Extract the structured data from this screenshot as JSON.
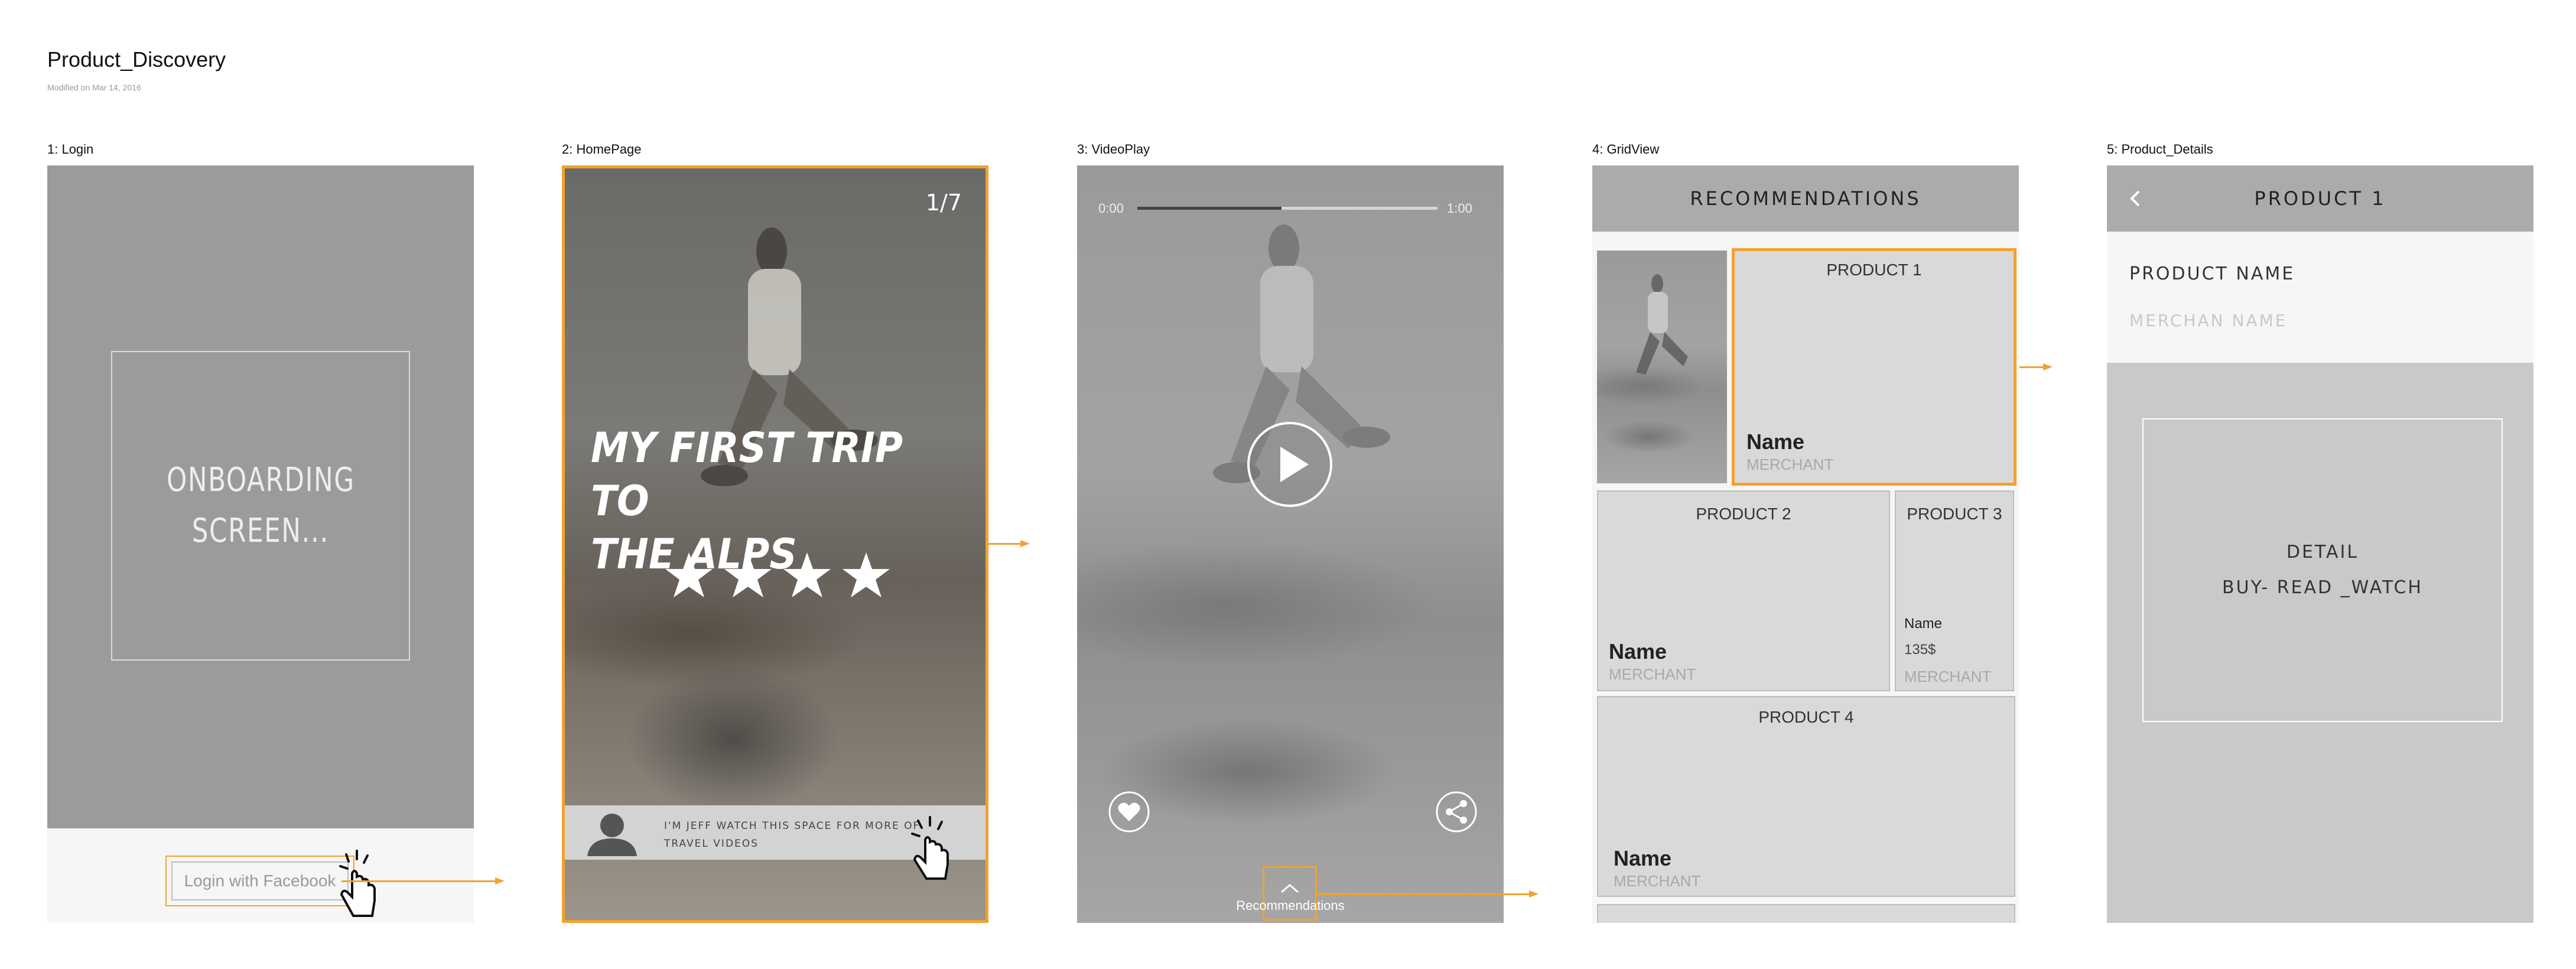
{
  "document": {
    "title": "Product_Discovery",
    "modified": "Modified on Mar 14, 2016"
  },
  "screens": [
    {
      "label": "1: Login"
    },
    {
      "label": "2: HomePage"
    },
    {
      "label": "3: VideoPlay"
    },
    {
      "label": "4: GridView"
    },
    {
      "label": "5: Product_Details"
    }
  ],
  "login": {
    "onboarding_line1": "ONBOARDING",
    "onboarding_line2": "SCREEN...",
    "facebook_button": "Login with Facebook"
  },
  "homepage": {
    "counter": "1/7",
    "headline_line1": "MY FIRST TRIP TO",
    "headline_line2": "THE ALPS",
    "rating": 4,
    "author_line1": "I'M JEFF WATCH THIS SPACE FOR MORE OF",
    "author_line2": "TRAVEL VIDEOS"
  },
  "videoplay": {
    "time_start": "0:00",
    "time_end": "1:00",
    "progress": 0.48,
    "recommendations_label": "Recommendations"
  },
  "gridview": {
    "header": "RECOMMENDATIONS",
    "products": [
      {
        "title": "PRODUCT 1",
        "name": "Name",
        "merchant": "MERCHANT"
      },
      {
        "title": "PRODUCT 2",
        "name": "Name",
        "merchant": "MERCHANT"
      },
      {
        "title": "PRODUCT 3",
        "name": "Name",
        "price": "135$",
        "merchant": "MERCHANT"
      },
      {
        "title": "PRODUCT 4",
        "name": "Name",
        "merchant": "MERCHANT"
      }
    ]
  },
  "details": {
    "header": "PRODUCT 1",
    "product_name": "PRODUCT NAME",
    "merchant_name": "MERCHAN NAME",
    "detail_line1": "DETAIL",
    "detail_line2": "BUY- READ _WATCH"
  },
  "colors": {
    "accent": "#f2a22e",
    "frame_gray": "#9b9b9b",
    "panel_gray": "#d9d9d9"
  }
}
